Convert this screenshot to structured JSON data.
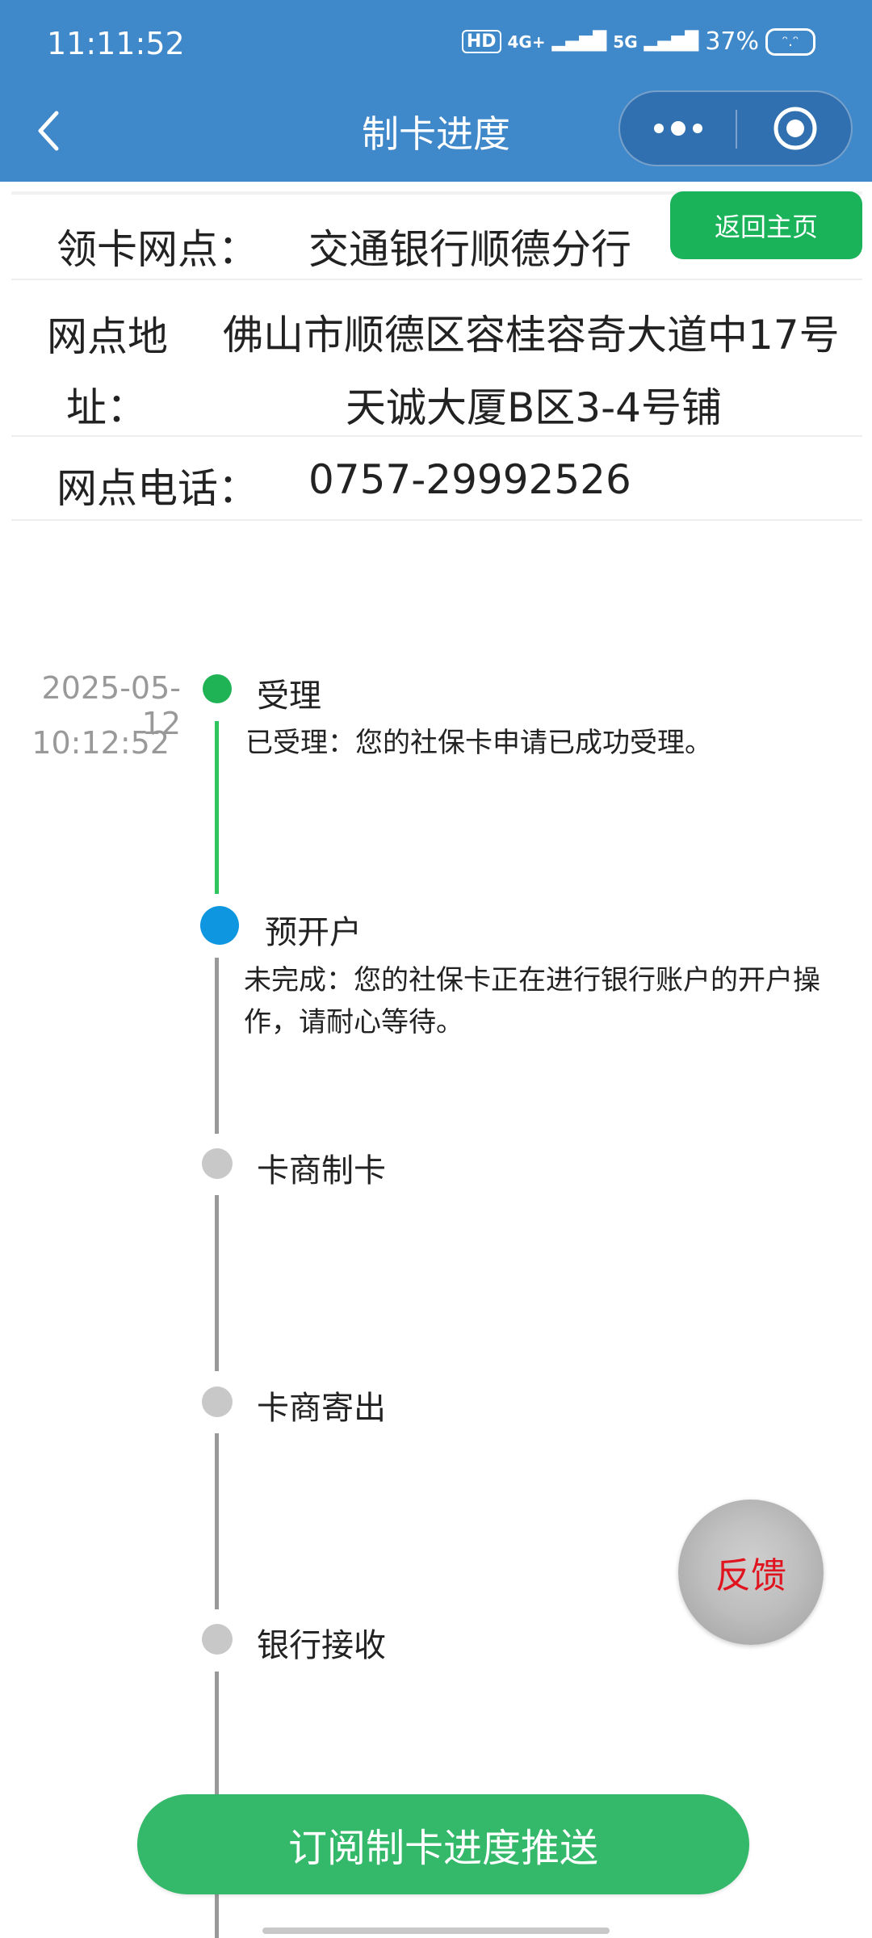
{
  "status_bar": {
    "time": "11:11:52",
    "hd": "HD",
    "net1": "4G+",
    "net2": "5G",
    "battery": "37%"
  },
  "header": {
    "title": "制卡进度",
    "back_icon": "chevron-left-icon",
    "more_icon": "more-dots-icon",
    "close_icon": "target-close-icon"
  },
  "info": {
    "home_button": "返回主页",
    "branch_label": "领卡网点：",
    "branch_value": "交通银行顺德分行",
    "address_label_1": "网点地",
    "address_label_2": "址：",
    "address_line1": "佛山市顺德区容桂容奇大道中17号",
    "address_line2": "天诚大厦B区3-4号铺",
    "phone_label": "网点电话：",
    "phone_value": "0757-29992526"
  },
  "timeline": [
    {
      "title": "受理",
      "desc": "已受理：您的社保卡申请已成功受理。",
      "date": "2025-05-12",
      "time": "10:12:52",
      "status": "done",
      "color": "#1fb356"
    },
    {
      "title": "预开户",
      "desc": "未完成：您的社保卡正在进行银行账户的开户操作，请耐心等待。",
      "date": "",
      "time": "",
      "status": "current",
      "color": "#0f96e0"
    },
    {
      "title": "卡商制卡",
      "desc": "",
      "status": "pending",
      "color": "#c8c8c8"
    },
    {
      "title": "卡商寄出",
      "desc": "",
      "status": "pending",
      "color": "#c8c8c8"
    },
    {
      "title": "银行接收",
      "desc": "",
      "status": "pending",
      "color": "#c8c8c8"
    }
  ],
  "feedback_button": "反馈",
  "subscribe_button": "订阅制卡进度推送"
}
